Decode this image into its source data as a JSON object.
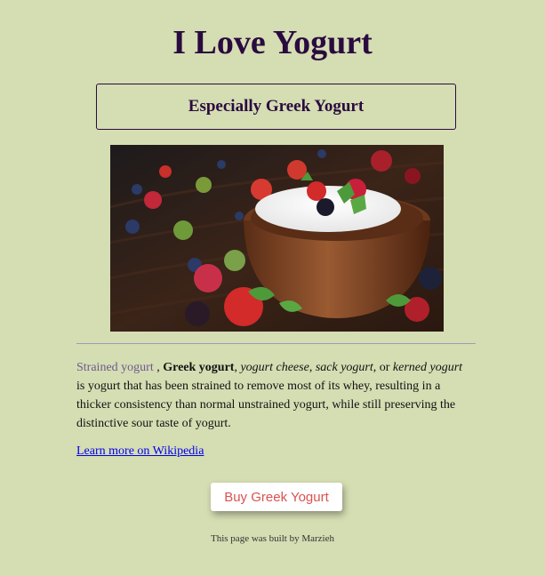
{
  "page": {
    "title": "I Love Yogurt",
    "subtitle": "Especially Greek Yogurt"
  },
  "hero_image": {
    "alt": "bowl of greek yogurt with berries and mint"
  },
  "description": {
    "link_term": "Strained yogurt",
    "sep1": " , ",
    "bold_term": "Greek yogurt",
    "sep2": ", ",
    "italic1": "yogurt cheese",
    "sep3": ", ",
    "italic2": "sack yogurt",
    "sep4": ", or ",
    "italic3": "kerned yogurt",
    "rest": " is yogurt that has been strained to remove most of its whey, resulting in a thicker consistency than normal unstrained yogurt, while still preserving the distinctive sour taste of yogurt."
  },
  "links": {
    "wikipedia": "Learn more on Wikipedia"
  },
  "actions": {
    "buy": "Buy Greek Yogurt"
  },
  "footer": {
    "text": "This page was built by Marzieh"
  },
  "colors": {
    "background": "#d5ddb3",
    "title": "#2a0b3f",
    "button_text": "#d9534f",
    "term_link": "#6f5a8e"
  }
}
